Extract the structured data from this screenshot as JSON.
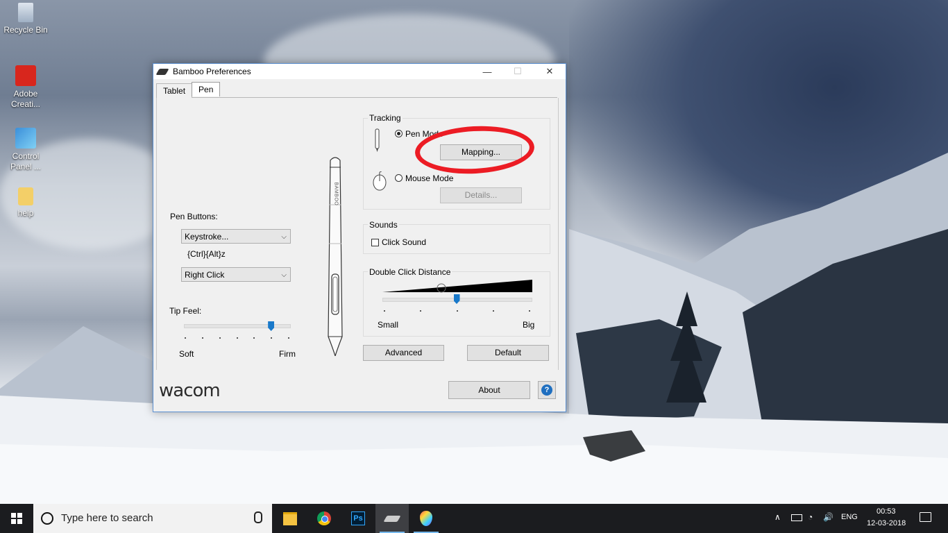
{
  "desktop": {
    "icons": [
      {
        "label": "Recycle Bin"
      },
      {
        "label": "Adobe Creati..."
      },
      {
        "label": "Control Panel ..."
      },
      {
        "label": "help"
      }
    ]
  },
  "window": {
    "title": "Bamboo Preferences",
    "controls": {
      "minimize": "—",
      "maximize": "☐",
      "close": "✕"
    },
    "tabs": [
      {
        "label": "Tablet"
      },
      {
        "label": "Pen"
      }
    ],
    "pen_buttons": {
      "label": "Pen Buttons:",
      "upper_value": "Keystroke...",
      "upper_keystroke": "{Ctrl}{Alt}z",
      "lower_value": "Right Click"
    },
    "tip_feel": {
      "label": "Tip Feel:",
      "min_label": "Soft",
      "max_label": "Firm",
      "level_step": 5,
      "steps": 7
    },
    "pen_brand": "BAMBOO",
    "tracking": {
      "title": "Tracking",
      "pen_mode": "Pen Mode",
      "mapping": "Mapping...",
      "mouse_mode": "Mouse Mode",
      "details": "Details..."
    },
    "sounds": {
      "title": "Sounds",
      "click_sound": "Click Sound",
      "checked": false
    },
    "double_click": {
      "title": "Double Click Distance",
      "min_label": "Small",
      "max_label": "Big",
      "level_step": 2,
      "steps": 5
    },
    "buttons": {
      "advanced": "Advanced",
      "default": "Default",
      "about": "About",
      "help": "?"
    },
    "logo": "wacom"
  },
  "annotation_color": "#ec1c24",
  "taskbar": {
    "search_placeholder": "Type here to search",
    "apps": [
      "file-explorer-icon",
      "chrome-icon",
      "photoshop-icon",
      "bamboo-icon",
      "paint-icon"
    ],
    "photoshop_label": "Ps",
    "language": "ENG",
    "time": "00:53",
    "date": "12-03-2018"
  }
}
